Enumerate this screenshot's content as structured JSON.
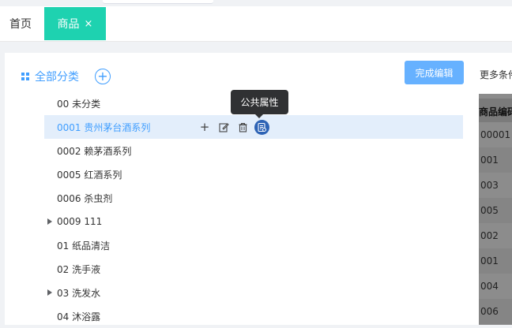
{
  "tabs": [
    {
      "label": "首页",
      "active": false
    },
    {
      "label": "商品",
      "active": true,
      "close": "×"
    }
  ],
  "category": {
    "title": "全部分类",
    "add_symbol": "+",
    "done_button": "完成编辑"
  },
  "tree": [
    {
      "label": "00 未分类",
      "expandable": false
    },
    {
      "label": "0001 贵州茅台酒系列",
      "expandable": false,
      "selected": true
    },
    {
      "label": "0002 赖茅酒系列",
      "expandable": false
    },
    {
      "label": "0005 红酒系列",
      "expandable": false
    },
    {
      "label": "0006 杀虫剂",
      "expandable": false
    },
    {
      "label": "0009 111",
      "expandable": true
    },
    {
      "label": "01 纸品清洁",
      "expandable": false
    },
    {
      "label": "02 洗手液",
      "expandable": false
    },
    {
      "label": "03 洗发水",
      "expandable": true
    },
    {
      "label": "04 沐浴露",
      "expandable": false
    }
  ],
  "node_actions": {
    "add": "+",
    "icons": [
      "plus-icon",
      "edit-icon",
      "trash-icon",
      "attribute-icon"
    ]
  },
  "tooltip": "公共属性",
  "background_table": {
    "filter_label": "更多条件",
    "column_header": "商品编码",
    "cells": [
      "00001",
      "001",
      "003",
      "005",
      "002",
      "001",
      "004",
      "006"
    ]
  },
  "colors": {
    "accent": "#409eff",
    "tab_active": "#1ed2b0",
    "done_button": "#66b1ff",
    "selected_row": "#e3eefb",
    "tooltip_bg": "#303133"
  }
}
